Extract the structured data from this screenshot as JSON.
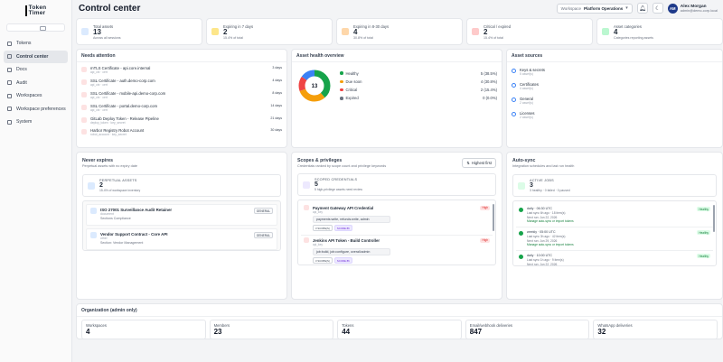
{
  "sidebar": {
    "logo_line1": "Token",
    "logo_line2": "Timer",
    "items": [
      {
        "label": "Tokens",
        "icon": "key-icon"
      },
      {
        "label": "Control center",
        "icon": "dashboard-icon"
      },
      {
        "label": "Docs",
        "icon": "doc-icon"
      },
      {
        "label": "Audit",
        "icon": "audit-icon"
      },
      {
        "label": "Workspaces",
        "icon": "folder-icon"
      },
      {
        "label": "Workspace preferences",
        "icon": "settings-icon"
      },
      {
        "label": "System",
        "icon": "system-icon"
      }
    ]
  },
  "header": {
    "title": "Control center",
    "workspace_label": "Workspace",
    "workspace_value": "Platform Operations",
    "user_initials": "AM",
    "user_name": "Alex Morgan",
    "user_email": "admin@demo-corp.local"
  },
  "kpis": [
    {
      "label": "Total assets",
      "value": "13",
      "sub": "Across all sessions",
      "color": "#dbeafe"
    },
    {
      "label": "Expiring in 7 days",
      "value": "2",
      "sub": "15.4% of total",
      "color": "#fde68a"
    },
    {
      "label": "Expiring in 8-30 days",
      "value": "4",
      "sub": "30.8% of total",
      "color": "#fed7aa"
    },
    {
      "label": "Critical / expired",
      "value": "2",
      "sub": "15.4% of total",
      "color": "#fecaca"
    },
    {
      "label": "Asset categories",
      "value": "4",
      "sub": "Categories reporting assets",
      "color": "#bbf7d0"
    }
  ],
  "needs_attention": {
    "title": "Needs attention",
    "items": [
      {
        "name": "mTLS Certificate - api.core.internal",
        "sub": "api_ctx · cert",
        "days": "3 days"
      },
      {
        "name": "SSL Certificate - auth.demo-corp.com",
        "sub": "api_ctx · cert",
        "days": "4 days"
      },
      {
        "name": "SSL Certificate - mobile-api.demo-corp.com",
        "sub": "api_ctx · cert",
        "days": "8 days"
      },
      {
        "name": "SSL Certificate - portal.demo-corp.com",
        "sub": "api_ctx · cert",
        "days": "14 days"
      },
      {
        "name": "GitLab Deploy Token - Release Pipeline",
        "sub": "deploy_token · key_secret",
        "days": "21 days"
      },
      {
        "name": "Harbor Registry Robot Account",
        "sub": "robot_account · key_secret",
        "days": "30 days"
      }
    ]
  },
  "asset_health": {
    "title": "Asset health overview",
    "center": "13",
    "items": [
      {
        "label": "Healthy",
        "value": "5 (38.5%)",
        "color": "#16a34a",
        "fraction": 0.385
      },
      {
        "label": "Due soon",
        "value": "4 (30.8%)",
        "color": "#f59e0b",
        "fraction": 0.308
      },
      {
        "label": "Critical",
        "value": "2 (15.4%)",
        "color": "#ef4444",
        "fraction": 0.154
      },
      {
        "label": "Expired",
        "value": "0 (0.0%)",
        "color": "#6b7280",
        "fraction": 0.0
      }
    ],
    "remaining_color": "#3b82f6",
    "remaining_fraction": 0.154
  },
  "asset_sources": {
    "title": "Asset sources",
    "items": [
      {
        "name": "Keys & secrets",
        "count": "5 asset(s)"
      },
      {
        "name": "Certificates",
        "count": "4 asset(s)"
      },
      {
        "name": "General",
        "count": "2 asset(s)"
      },
      {
        "name": "Licenses",
        "count": "2 asset(s)"
      }
    ]
  },
  "never_expires": {
    "title": "Never expires",
    "subtitle": "Perpetual assets with no expiry date",
    "box_label": "PERPETUAL ASSETS",
    "box_value": "2",
    "box_sub": "15.4% of workspace inventory",
    "items": [
      {
        "name": "ISO 27001 Surveillance Audit Retainer",
        "type": "document",
        "dept": "Sections Compliance",
        "tag": "GENERAL"
      },
      {
        "name": "Vendor Support Contract - Core API",
        "type": "other",
        "dept": "Section: Vendor Management",
        "tag": "GENERAL"
      }
    ]
  },
  "scopes": {
    "title": "Scopes & privileges",
    "subtitle": "Credentials ranked by scope count and privilege keywords",
    "filter_label": "Highest first",
    "box_label": "SCOPED CREDENTIALS",
    "box_value": "5",
    "box_sub": "5 high-privilege assets need review",
    "items": [
      {
        "name": "Payment Gateway API Credential",
        "sub": "api_key",
        "badge": "High",
        "perm": "payments:write, refunds:write, admin",
        "pill1": "3 SCOPE(S)",
        "pill2": "SCORE 86"
      },
      {
        "name": "Jenkins API Token - Build Controller",
        "sub": "api_key",
        "badge": "High",
        "perm": "job:build, job:configure, overall:admin",
        "pill1": "3 SCOPE(S)",
        "pill2": "SCORE 86"
      },
      {
        "name": "Harbor Registry Robot Account",
        "sub": "robot_account",
        "badge": "High",
        "perm": "",
        "pill1": "",
        "pill2": ""
      }
    ]
  },
  "auto_sync": {
    "title": "Auto-sync",
    "subtitle": "Integration schedules and last run health",
    "box_label": "ACTIVE JOBS",
    "box_value": "3",
    "box_sub": "3 healthy · 0 failed · 0 paused",
    "items": [
      {
        "title": "daily · 06:30 UTC",
        "last": "Last sync 6h ago · 18 item(s)",
        "next": "Next run: Jun 22, 2026",
        "manage": "Manage auto-sync or import tokens",
        "badge": "Healthy"
      },
      {
        "title": "weekly · 05:00 UTC",
        "last": "Last sync 3h ago · 42 item(s)",
        "next": "Next run: Jun 29, 2026",
        "manage": "Manage auto-sync or import tokens",
        "badge": "Healthy"
      },
      {
        "title": "daily · 10:00 UTC",
        "last": "Last sync 1h ago · 9 item(s)",
        "next": "Next run: Jun 22, 2026",
        "manage": "",
        "badge": "Healthy"
      }
    ]
  },
  "organization": {
    "title": "Organization (admin only)",
    "cards": [
      {
        "label": "Workspaces",
        "value": "4"
      },
      {
        "label": "Members",
        "value": "23"
      },
      {
        "label": "Tokens",
        "value": "44"
      },
      {
        "label": "Email/webhook deliveries",
        "value": "847"
      },
      {
        "label": "WhatsApp deliveries",
        "value": "32"
      }
    ]
  }
}
